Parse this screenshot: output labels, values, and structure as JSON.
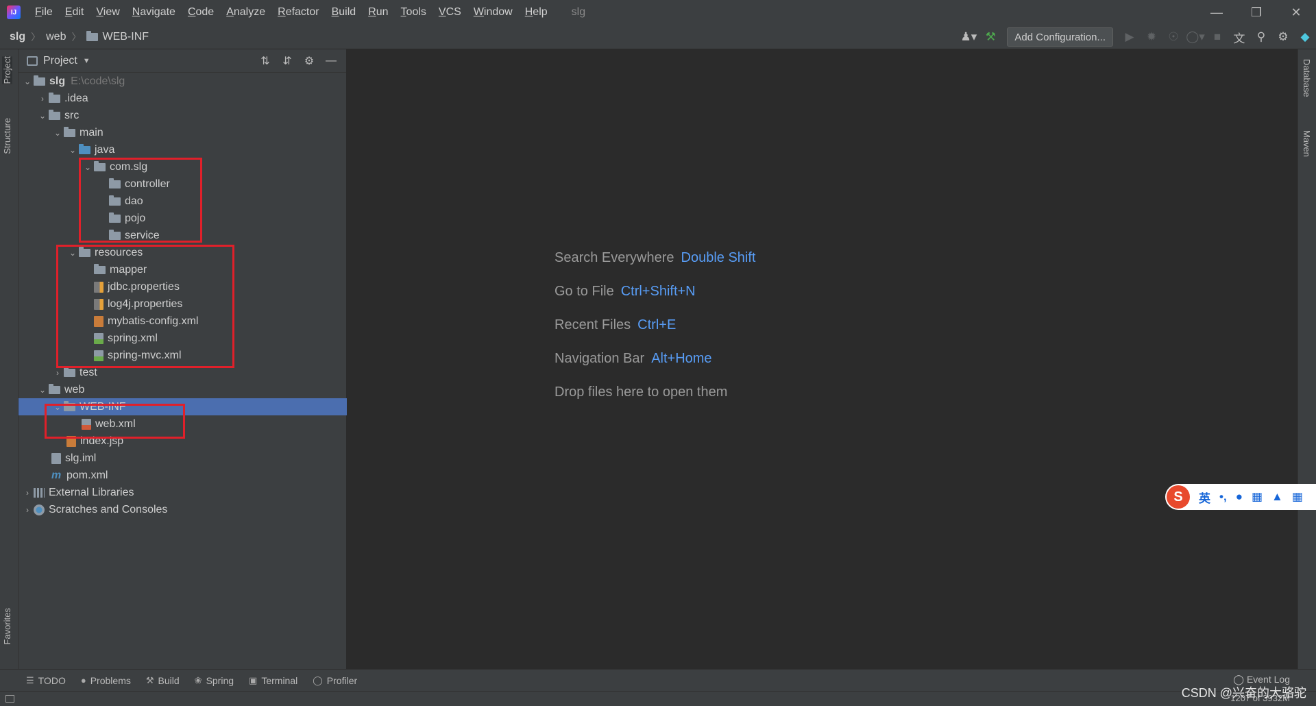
{
  "menubar": {
    "items": [
      "File",
      "Edit",
      "View",
      "Navigate",
      "Code",
      "Analyze",
      "Refactor",
      "Build",
      "Run",
      "Tools",
      "VCS",
      "Window",
      "Help"
    ],
    "project_title": "slg"
  },
  "breadcrumb": {
    "root": "slg",
    "web": "web",
    "webinf": "WEB-INF"
  },
  "toolbar": {
    "add_configuration": "Add Configuration..."
  },
  "side_tabs": {
    "project": "Project",
    "structure": "Structure",
    "favorites": "Favorites",
    "database": "Database",
    "maven": "Maven"
  },
  "project_panel": {
    "title": "Project"
  },
  "tree": {
    "slg": "slg",
    "slg_path": "E:\\code\\slg",
    "idea": ".idea",
    "src": "src",
    "main": "main",
    "java": "java",
    "com_slg": "com.slg",
    "controller": "controller",
    "dao": "dao",
    "pojo": "pojo",
    "service": "service",
    "resources": "resources",
    "mapper": "mapper",
    "jdbc": "jdbc.properties",
    "log4j": "log4j.properties",
    "mybatis": "mybatis-config.xml",
    "spring": "spring.xml",
    "spring_mvc": "spring-mvc.xml",
    "test": "test",
    "web": "web",
    "webinf": "WEB-INF",
    "webxml": "web.xml",
    "index": "index.jsp",
    "iml": "slg.iml",
    "pom": "pom.xml",
    "external": "External Libraries",
    "scratches": "Scratches and Consoles"
  },
  "editor_hints": [
    {
      "label": "Search Everywhere",
      "key": "Double Shift"
    },
    {
      "label": "Go to File",
      "key": "Ctrl+Shift+N"
    },
    {
      "label": "Recent Files",
      "key": "Ctrl+E"
    },
    {
      "label": "Navigation Bar",
      "key": "Alt+Home"
    },
    {
      "label": "Drop files here to open them",
      "key": ""
    }
  ],
  "bottom_tabs": [
    "TODO",
    "Problems",
    "Build",
    "Spring",
    "Terminal",
    "Profiler"
  ],
  "event_log": "Event Log",
  "status": {
    "memory": "1207 of 3932M"
  },
  "watermark": "CSDN @兴奋的大骆驼",
  "ime": {
    "lang": "英"
  },
  "colors": {
    "accent": "#589df6",
    "selection": "#4b6eaf",
    "annotation_box": "#e0202a"
  }
}
